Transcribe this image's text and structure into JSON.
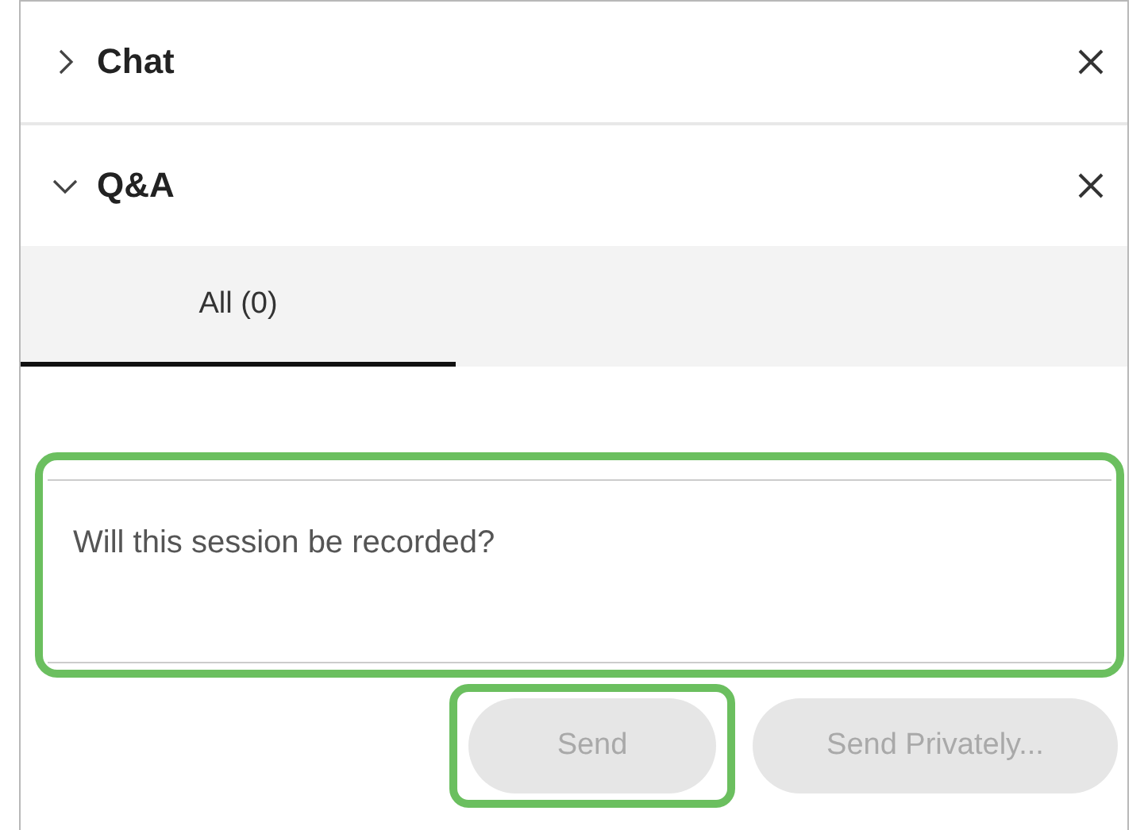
{
  "panels": [
    {
      "title": "Chat",
      "expanded": false
    },
    {
      "title": "Q&A",
      "expanded": true
    }
  ],
  "tabs": [
    {
      "label": "All (0)",
      "selected": true
    }
  ],
  "question": {
    "value": "Will this session be recorded?",
    "highlighted": true
  },
  "buttons": [
    {
      "label": "Send",
      "disabled": true,
      "highlighted": true
    },
    {
      "label": "Send Privately...",
      "disabled": true,
      "highlighted": false
    }
  ]
}
